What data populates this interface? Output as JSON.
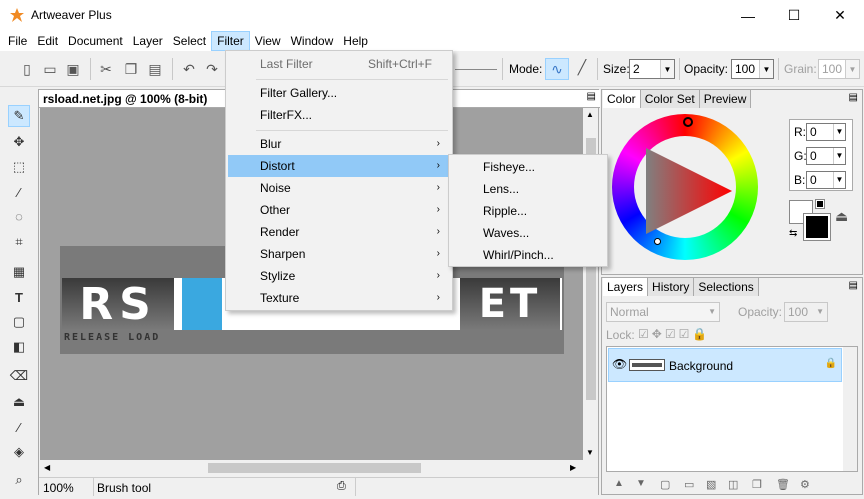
{
  "window": {
    "title": "Artweaver Plus",
    "minimize": "—",
    "maximize": "☐",
    "close": "✕"
  },
  "menubar": [
    "File",
    "Edit",
    "Document",
    "Layer",
    "Select",
    "Filter",
    "View",
    "Window",
    "Help"
  ],
  "toolbar": {
    "mode_label": "Mode:",
    "size_label": "Size:",
    "size_value": "2",
    "opacity_label": "Opacity:",
    "opacity_value": "100",
    "grain_label": "Grain:",
    "grain_value": "100"
  },
  "document": {
    "title": "rsload.net.jpg @ 100% (8-bit)",
    "zoom": "100%",
    "status_tool": "Brush tool",
    "logo_left": "RS",
    "logo_right": "ET",
    "logo_sub": "RELEASE LOAD"
  },
  "filter_menu": {
    "last_filter": "Last Filter",
    "last_filter_shortcut": "Shift+Ctrl+F",
    "gallery": "Filter Gallery...",
    "filterfx": "FilterFX...",
    "items": [
      "Blur",
      "Distort",
      "Noise",
      "Other",
      "Render",
      "Sharpen",
      "Stylize",
      "Texture"
    ]
  },
  "distort_menu": [
    "Fisheye...",
    "Lens...",
    "Ripple...",
    "Waves...",
    "Whirl/Pinch..."
  ],
  "color_panel": {
    "tabs": [
      "Color",
      "Color Set",
      "Preview"
    ],
    "r_label": "R:",
    "g_label": "G:",
    "b_label": "B:",
    "r": "0",
    "g": "0",
    "b": "0"
  },
  "layers_panel": {
    "tabs": [
      "Layers",
      "History",
      "Selections"
    ],
    "blend_mode": "Normal",
    "opacity_label": "Opacity:",
    "opacity_value": "100",
    "lock_label": "Lock:",
    "layer_name": "Background"
  },
  "colors": {
    "accent": "#91c9f7",
    "selection": "#cce8ff"
  }
}
